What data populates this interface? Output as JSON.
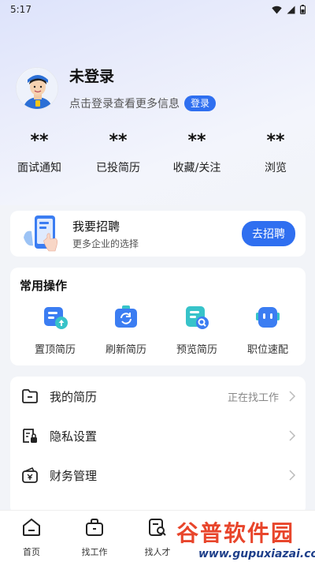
{
  "status_bar": {
    "time": "5:17"
  },
  "profile": {
    "username": "未登录",
    "hint": "点击登录查看更多信息",
    "login_button": "登录"
  },
  "stats": [
    {
      "value": "**",
      "label": "面试通知"
    },
    {
      "value": "**",
      "label": "已投简历"
    },
    {
      "value": "**",
      "label": "收藏/关注"
    },
    {
      "value": "**",
      "label": "浏览"
    }
  ],
  "recruit": {
    "title": "我要招聘",
    "subtitle": "更多企业的选择",
    "button": "去招聘"
  },
  "common_actions": {
    "title": "常用操作",
    "items": [
      {
        "label": "置顶简历",
        "icon": "upload-resume-icon"
      },
      {
        "label": "刷新简历",
        "icon": "refresh-resume-icon"
      },
      {
        "label": "预览简历",
        "icon": "preview-resume-icon"
      },
      {
        "label": "职位速配",
        "icon": "robot-match-icon"
      }
    ]
  },
  "menu": [
    {
      "label": "我的简历",
      "extra": "正在找工作",
      "icon": "folder-icon"
    },
    {
      "label": "隐私设置",
      "extra": "",
      "icon": "privacy-lock-icon"
    },
    {
      "label": "财务管理",
      "extra": "",
      "icon": "wallet-icon"
    }
  ],
  "tabbar": [
    {
      "label": "首页",
      "icon": "home-icon"
    },
    {
      "label": "找工作",
      "icon": "briefcase-icon"
    },
    {
      "label": "找人才",
      "icon": "find-talent-icon"
    }
  ],
  "watermark": {
    "title": "谷普软件园",
    "url": "www.gupuxiazai.com"
  },
  "colors": {
    "accent": "#2f6ff0",
    "background": "#f2f4f8"
  }
}
